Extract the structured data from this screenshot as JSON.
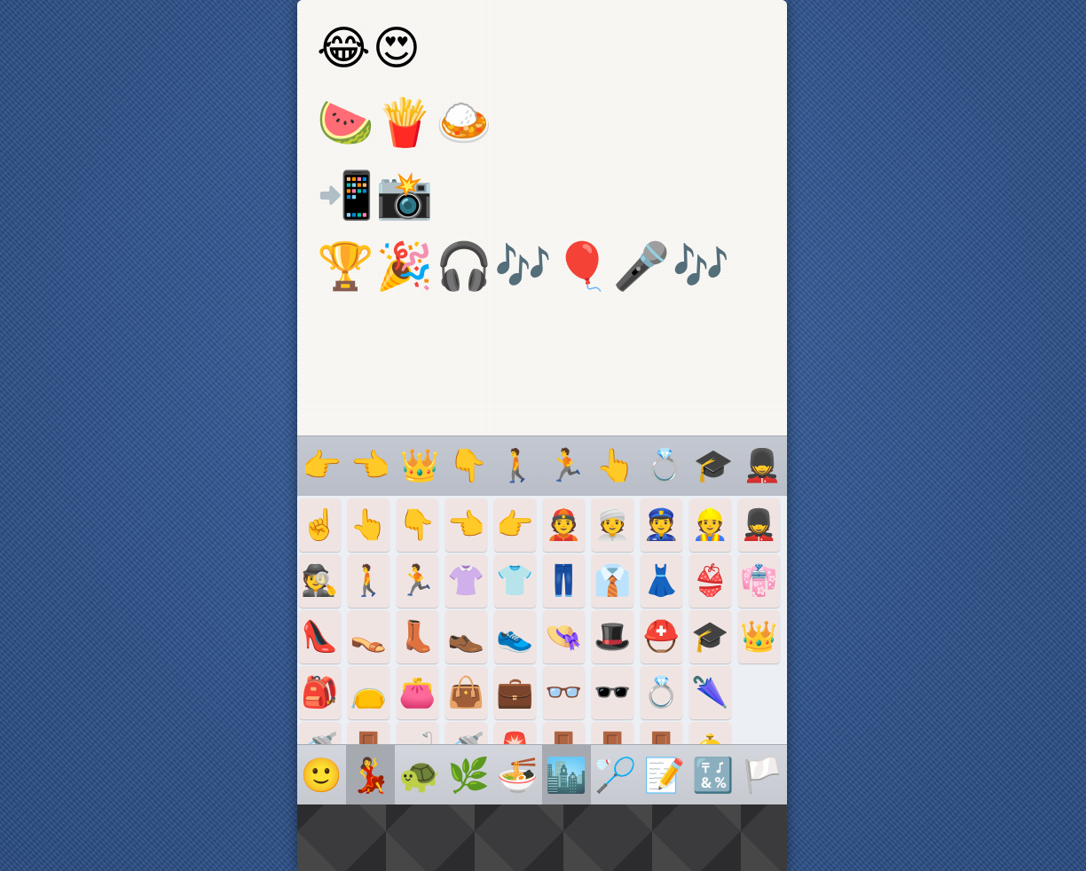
{
  "compose": {
    "lines": [
      "😂😍",
      "🍉🍟🍛",
      "📲📸",
      "🏆🎉🎧🎶🎈🎤🎶"
    ]
  },
  "recents": [
    "👉",
    "👈",
    "👑",
    "👇",
    "🚶",
    "🏃",
    "👆",
    "💍",
    "🎓",
    "💂"
  ],
  "grid": [
    [
      "☝️",
      "👆",
      "👇",
      "👈",
      "👉",
      "👲",
      "👳",
      "👮",
      "👷",
      "💂"
    ],
    [
      "🕵️",
      "🚶",
      "🏃",
      "👚",
      "👕",
      "👖",
      "👔",
      "👗",
      "👙",
      "👘"
    ],
    [
      "👠",
      "👡",
      "👢",
      "👞",
      "👟",
      "👒",
      "🎩",
      "⛑️",
      "🎓",
      "👑"
    ],
    [
      "🎒",
      "👝",
      "👛",
      "👜",
      "💼",
      "👓",
      "🕶️",
      "💍",
      "🌂",
      ""
    ],
    [
      "🚿",
      "🚪",
      "🛁",
      "🚿",
      "🚨",
      "🚪",
      "🚪",
      "🚪",
      "🛎️",
      ""
    ]
  ],
  "categories": [
    {
      "label": "🙂",
      "name": "smileys",
      "selected": false
    },
    {
      "label": "💃",
      "name": "people",
      "selected": true
    },
    {
      "label": "🐢",
      "name": "animals",
      "selected": false
    },
    {
      "label": "🌿",
      "name": "nature",
      "selected": false
    },
    {
      "label": "🍜",
      "name": "food",
      "selected": false
    },
    {
      "label": "🏙️",
      "name": "places",
      "selected": true
    },
    {
      "label": "🏸",
      "name": "activities",
      "selected": false
    },
    {
      "label": "📝",
      "name": "objects",
      "selected": false
    },
    {
      "label": "🔣",
      "name": "symbols",
      "selected": false
    },
    {
      "label": "🏳️",
      "name": "flags",
      "selected": false
    }
  ]
}
